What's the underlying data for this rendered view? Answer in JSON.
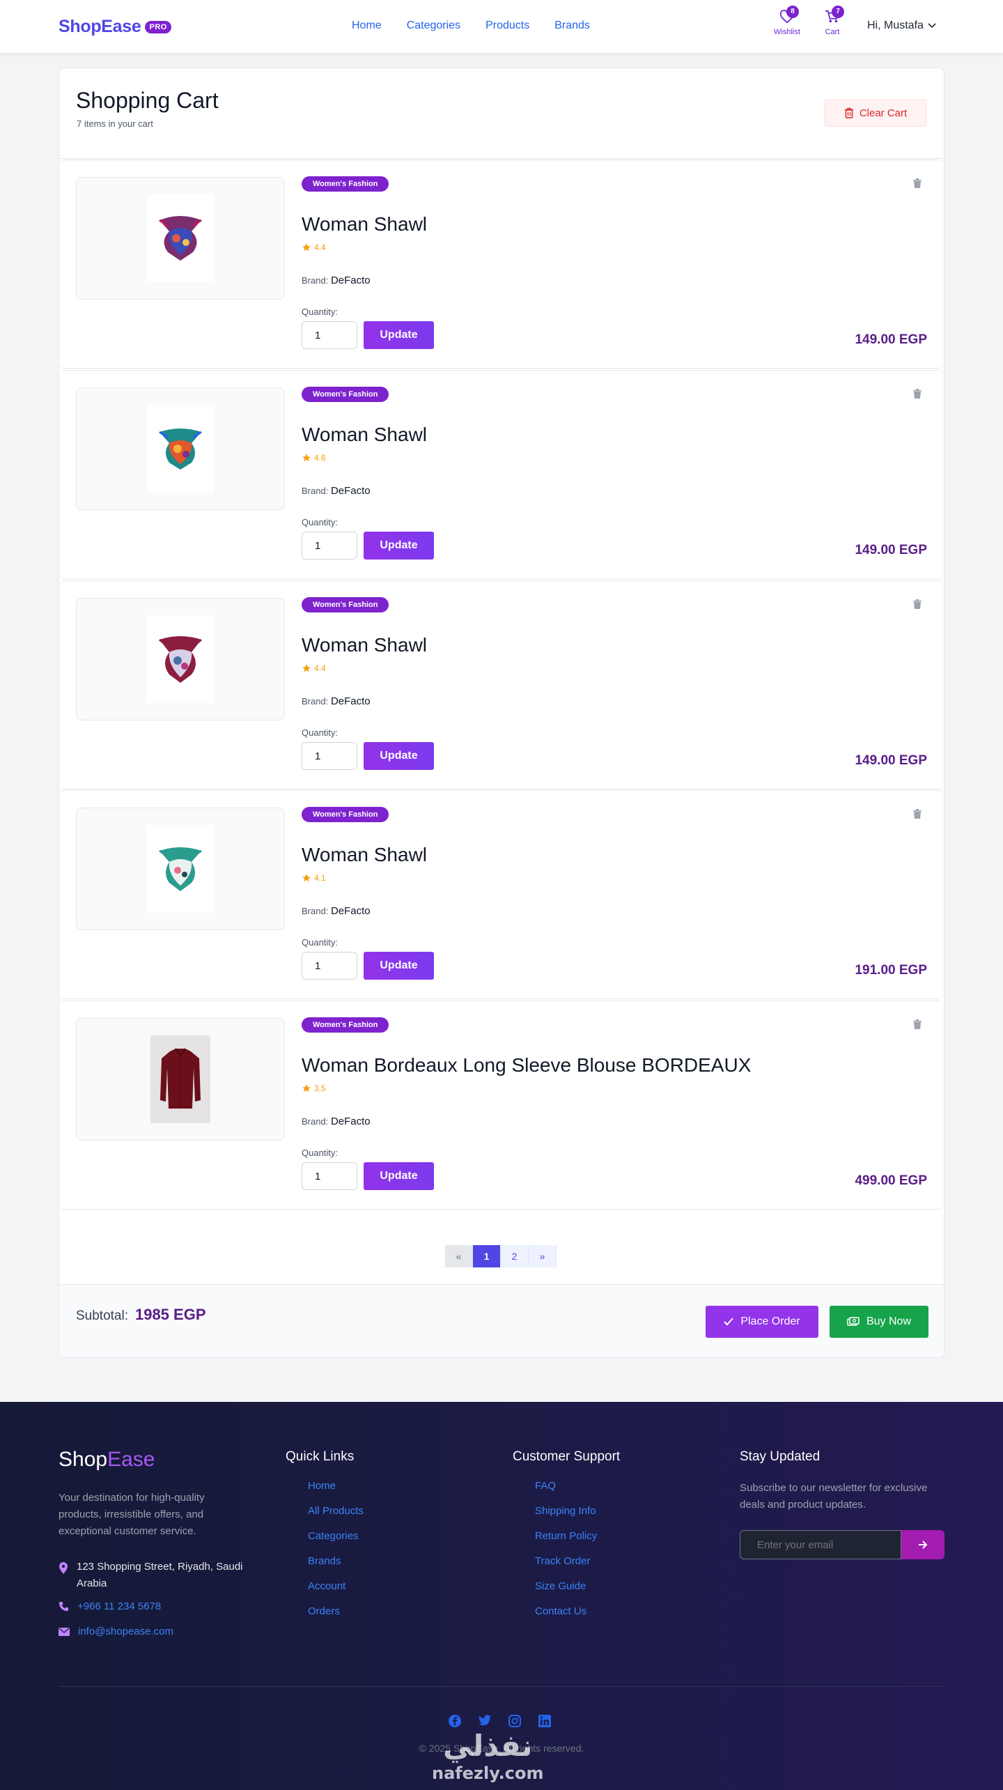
{
  "navbar": {
    "logo": "ShopEase",
    "logo_badge": "PRO",
    "links": [
      "Home",
      "Categories",
      "Products",
      "Brands"
    ],
    "wishlist": {
      "label": "Wishlist",
      "count": "8"
    },
    "cart": {
      "label": "Cart",
      "count": "7"
    },
    "user": "Hi, Mustafa"
  },
  "cart": {
    "title": "Shopping Cart",
    "subtitle": "7 items in your cart",
    "clear_label": "Clear Cart",
    "brand_label": "Brand:",
    "quantity_label": "Quantity:",
    "update_label": "Update",
    "items": [
      {
        "category": "Women's Fashion",
        "name": "Woman Shawl",
        "rating": "4.4",
        "brand": "DeFacto",
        "quantity": "1",
        "price": "149.00 EGP"
      },
      {
        "category": "Women's Fashion",
        "name": "Woman Shawl",
        "rating": "4.6",
        "brand": "DeFacto",
        "quantity": "1",
        "price": "149.00 EGP"
      },
      {
        "category": "Women's Fashion",
        "name": "Woman Shawl",
        "rating": "4.4",
        "brand": "DeFacto",
        "quantity": "1",
        "price": "149.00 EGP"
      },
      {
        "category": "Women's Fashion",
        "name": "Woman Shawl",
        "rating": "4.1",
        "brand": "DeFacto",
        "quantity": "1",
        "price": "191.00 EGP"
      },
      {
        "category": "Women's Fashion",
        "name": "Woman Bordeaux Long Sleeve Blouse BORDEAUX",
        "rating": "3.5",
        "brand": "DeFacto",
        "quantity": "1",
        "price": "499.00 EGP"
      }
    ],
    "pagination": {
      "prev": "«",
      "pages": [
        "1",
        "2"
      ],
      "next": "»",
      "current": "1"
    },
    "subtotal_label": "Subtotal:",
    "subtotal_value": "1985 EGP",
    "place_order_label": "Place Order",
    "buy_now_label": "Buy Now"
  },
  "footer": {
    "logo_part1": "Shop",
    "logo_part2": "Ease",
    "description": "Your destination for high-quality products, irresistible offers, and exceptional customer service.",
    "address": "123 Shopping Street, Riyadh, Saudi Arabia",
    "phone": "+966 11 234 5678",
    "email": "info@shopease.com",
    "quick_links_title": "Quick Links",
    "quick_links": [
      "Home",
      "All Products",
      "Categories",
      "Brands",
      "Account",
      "Orders"
    ],
    "support_title": "Customer Support",
    "support_links": [
      "FAQ",
      "Shipping Info",
      "Return Policy",
      "Track Order",
      "Size Guide",
      "Contact Us"
    ],
    "newsletter_title": "Stay Updated",
    "newsletter_desc": "Subscribe to our newsletter for exclusive deals and product updates.",
    "newsletter_placeholder": "Enter your email",
    "copyright": "© 2025 ShopEase. All rights reserved.",
    "watermark_ar": "نفذلي",
    "watermark_en": "nafezly.com"
  },
  "colors": {
    "brand": "#4f46e5",
    "accent": "#9333ea",
    "price": "#581c87",
    "danger": "#dc2626",
    "success": "#16a34a",
    "rating": "#f59e0b"
  }
}
